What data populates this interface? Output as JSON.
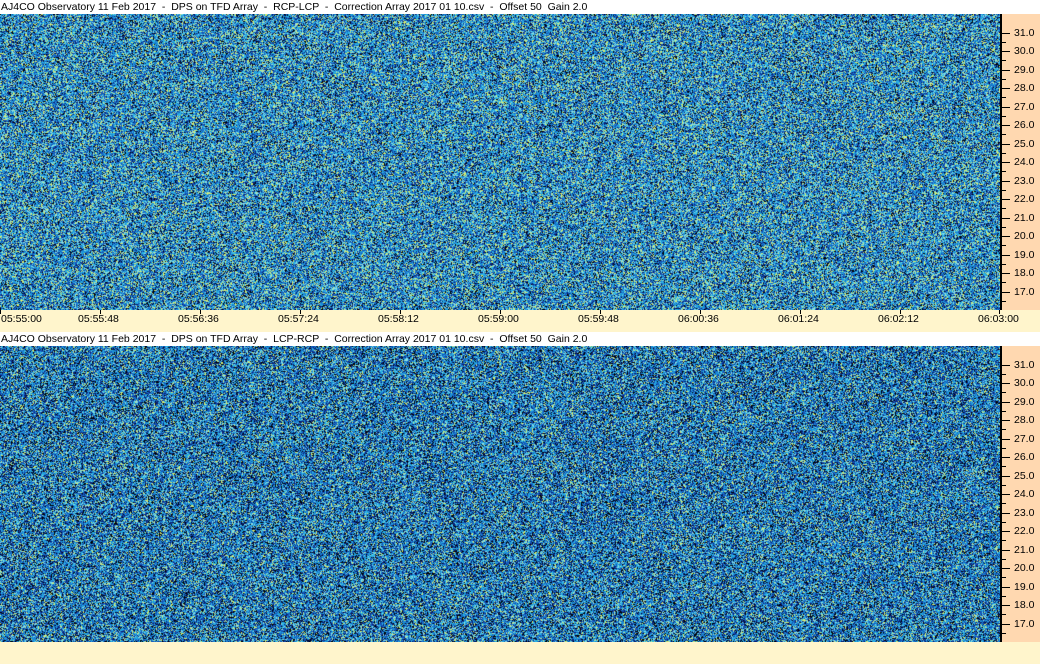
{
  "chart_data": [
    {
      "type": "heatmap",
      "title": "AJ4CO Observatory 11 Feb 2017  -  DPS on TFD Array  -  RCP-LCP  -  Correction Array 2017 01 10.csv  -  Offset 50  Gain 2.0",
      "y_ticks": [
        "31.0",
        "30.0",
        "29.0",
        "28.0",
        "27.0",
        "26.0",
        "25.0",
        "24.0",
        "23.0",
        "22.0",
        "21.0",
        "20.0",
        "19.0",
        "18.0",
        "17.0"
      ],
      "ylim": [
        16.0,
        32.0
      ],
      "x_ticks": [
        "05:55:00",
        "05:55:48",
        "05:56:36",
        "05:57:24",
        "05:58:12",
        "05:59:00",
        "05:59:48",
        "06:00:36",
        "06:01:24",
        "06:02:12",
        "06:03:00"
      ],
      "xlim": [
        "05:55:00",
        "06:03:00"
      ],
      "colormap": [
        "#000000",
        "#0a1d6e",
        "#1553b8",
        "#1b8ad6",
        "#2cb6e6",
        "#8fe0e0",
        "#d8f070"
      ],
      "mean_level": 0.52
    },
    {
      "type": "heatmap",
      "title": "AJ4CO Observatory 11 Feb 2017  -  DPS on TFD Array  -  LCP-RCP  -  Correction Array 2017 01 10.csv  -  Offset 50  Gain 2.0",
      "y_ticks": [
        "31.0",
        "30.0",
        "29.0",
        "28.0",
        "27.0",
        "26.0",
        "25.0",
        "24.0",
        "23.0",
        "22.0",
        "21.0",
        "20.0",
        "19.0",
        "18.0",
        "17.0"
      ],
      "ylim": [
        16.0,
        32.0
      ],
      "colormap": [
        "#000000",
        "#0a1d6e",
        "#1553b8",
        "#1b8ad6",
        "#2cb6e6",
        "#8fe0e0",
        "#d8f070"
      ],
      "mean_level": 0.46
    }
  ]
}
